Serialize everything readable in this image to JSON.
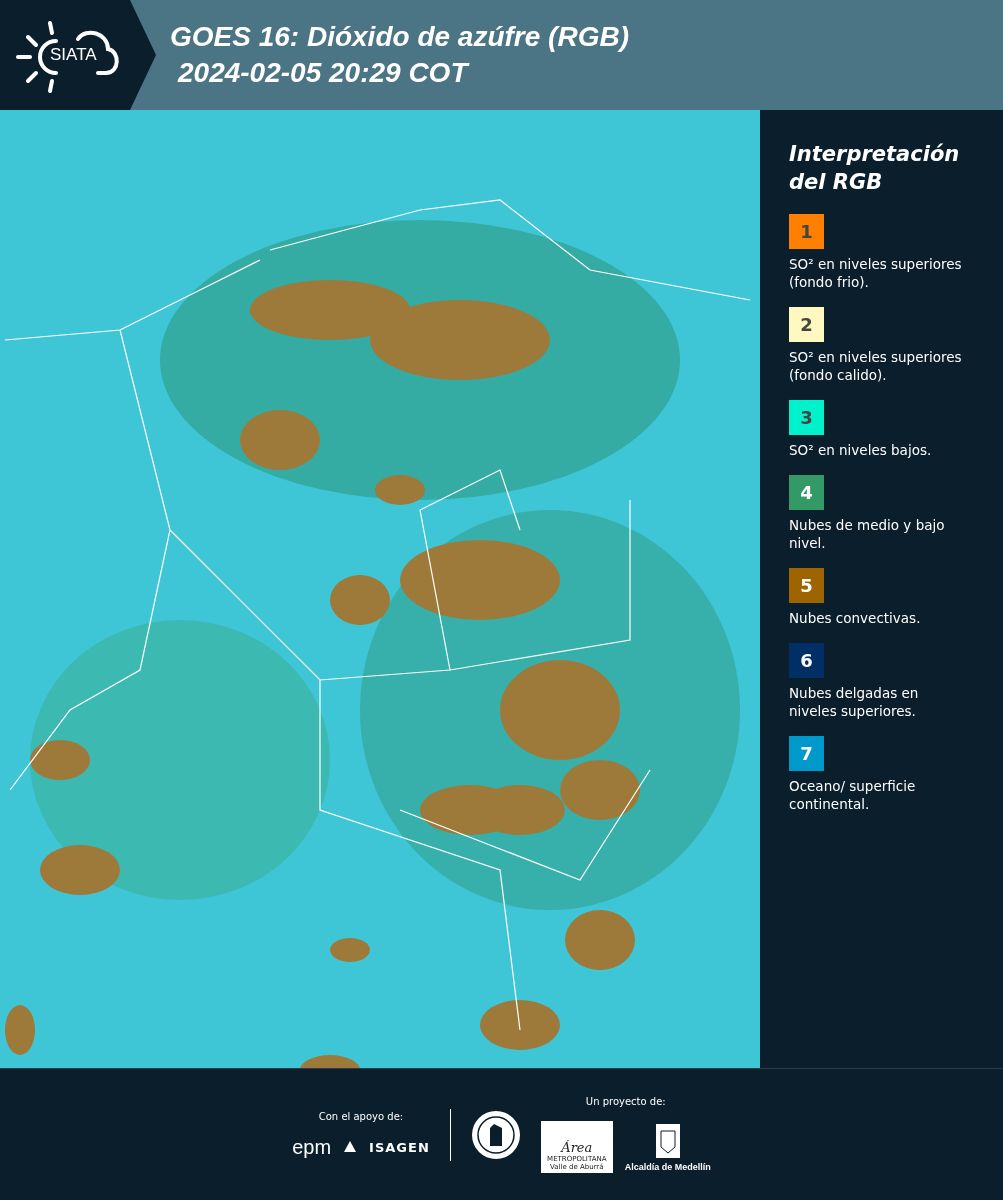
{
  "header": {
    "logo": "SIATA",
    "title": "GOES 16: Dióxido de azúfre (RGB)",
    "datetime": "2024-02-05 20:29 COT"
  },
  "legend": {
    "title": "Interpretación del RGB",
    "items": [
      {
        "number": "1",
        "color": "#ff7f00",
        "text": "SO² en niveles superiores (fondo frio)."
      },
      {
        "number": "2",
        "color": "#fff8c0",
        "text": "SO² en niveles superiores (fondo calido)."
      },
      {
        "number": "3",
        "color": "#00f2cc",
        "text": "SO² en niveles bajos."
      },
      {
        "number": "4",
        "color": "#339966",
        "text": "Nubes de medio y bajo nivel."
      },
      {
        "number": "5",
        "color": "#9e6400",
        "text": "Nubes convectivas."
      },
      {
        "number": "6",
        "color": "#002f66",
        "text": "Nubes delgadas en niveles superiores."
      },
      {
        "number": "7",
        "color": "#0099cc",
        "text": "Oceano/ superficie continental."
      }
    ]
  },
  "footer": {
    "support_label": "Con el apoyo de:",
    "support_logos": [
      "epm",
      "ISAGEN"
    ],
    "project_label": "Un proyecto de:",
    "area_logo": {
      "name": "Área",
      "line1": "METROPOLITANA",
      "line2": "Valle de Aburrá"
    },
    "alcaldia": "Alcaldía de Medellín"
  }
}
